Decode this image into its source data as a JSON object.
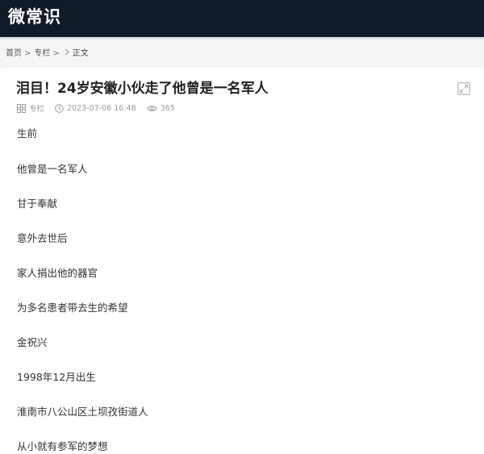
{
  "header": {
    "logo_text": "微常识"
  },
  "breadcrumb": {
    "items": [
      "首页",
      "专栏"
    ],
    "current": "正文"
  },
  "article": {
    "title": "泪目！24岁安徽小伙走了他曾是一名军人",
    "category": "专栏",
    "datetime": "2023-07-06 16:48",
    "views": "365",
    "paragraphs": [
      "生前",
      "他曾是一名军人",
      "甘于奉献",
      "意外去世后",
      "家人捐出他的器官",
      "为多名患者带去生的希望",
      "金祝兴",
      "1998年12月出生",
      "淮南市八公山区土坝孜街道人",
      "从小就有参军的梦想"
    ]
  },
  "icons": {
    "category": "grid-icon",
    "time": "clock-icon",
    "views": "eye-icon",
    "expand": "expand-icon"
  },
  "colors": {
    "header_bg": "#111a27",
    "page_bg": "#f4f5f7",
    "card_bg": "#ffffff",
    "meta_text": "#9a9a9a"
  }
}
